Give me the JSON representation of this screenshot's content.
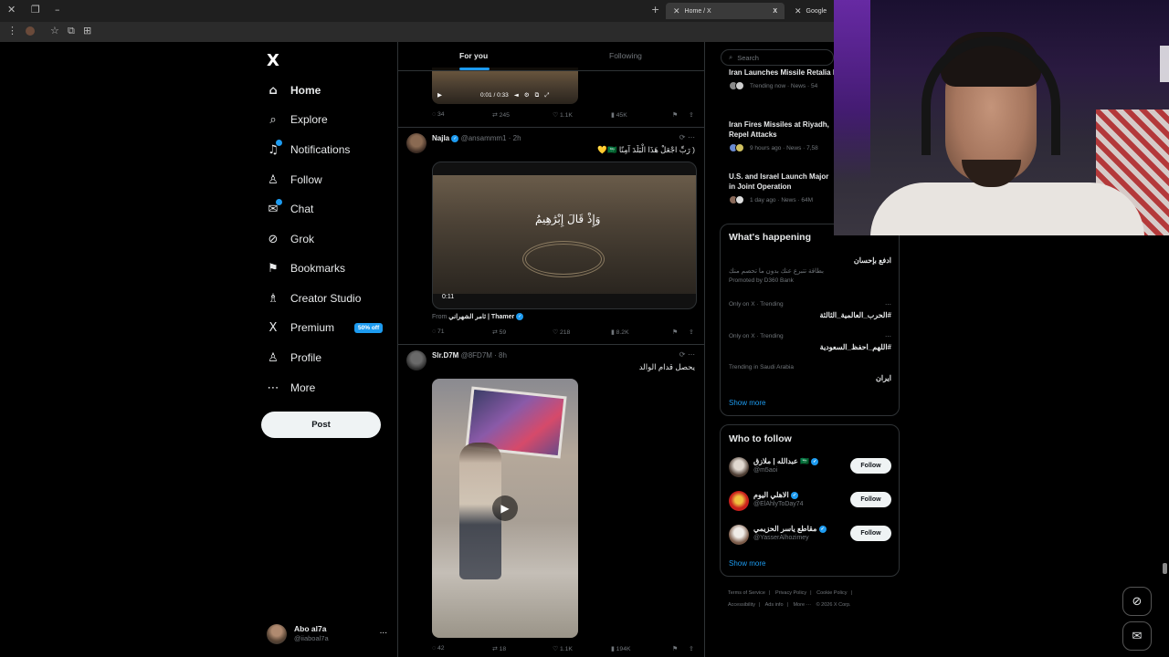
{
  "browser": {
    "tabs": [
      {
        "label": "Home / X",
        "active": true
      },
      {
        "label": "Google",
        "active": false
      }
    ]
  },
  "nav": {
    "logo": "X",
    "items": [
      {
        "label": "Home",
        "icon": "home-icon",
        "glyph": "⌂"
      },
      {
        "label": "Explore",
        "icon": "search-icon",
        "glyph": "⌕"
      },
      {
        "label": "Notifications",
        "icon": "bell-icon",
        "glyph": "♫"
      },
      {
        "label": "Follow",
        "icon": "person-add-icon",
        "glyph": "♙"
      },
      {
        "label": "Chat",
        "icon": "mail-icon",
        "glyph": "✉"
      },
      {
        "label": "Grok",
        "icon": "grok-icon",
        "glyph": "⊘"
      },
      {
        "label": "Bookmarks",
        "icon": "bookmark-icon",
        "glyph": "⚑"
      },
      {
        "label": "Creator Studio",
        "icon": "creator-icon",
        "glyph": "♗"
      },
      {
        "label": "Premium",
        "icon": "x-premium-icon",
        "glyph": "X"
      },
      {
        "label": "Profile",
        "icon": "profile-icon",
        "glyph": "♙"
      },
      {
        "label": "More",
        "icon": "more-circle-icon",
        "glyph": "⋯"
      }
    ],
    "premium_badge": "50% off",
    "post_button": "Post",
    "account": {
      "name": "Abo al7a",
      "handle": "@iiaboal7a",
      "more": "..."
    }
  },
  "feed": {
    "tabs": [
      "For you",
      "Following"
    ],
    "post0": {
      "video_time": "0:01 / 0:33",
      "actions": {
        "replies": "34",
        "reposts": "245",
        "likes": "1.1K",
        "views": "45K"
      }
    },
    "post1": {
      "name": "Najla",
      "handle": "@ansammm1",
      "time": "· 2h",
      "text": "( رَبِّ اجْعَلْ هَذَا الْبَلَدَ آمِنًا 🇸🇦💛",
      "media_caption": "وَإِذْ قَالَ إِبْرَٰهِيمُ",
      "video_time": "0:11",
      "from_label": "From",
      "from_name": "ثامر الشهراني | Thamer",
      "actions": {
        "replies": "71",
        "reposts": "59",
        "likes": "218",
        "views": "8.2K"
      }
    },
    "post2": {
      "name": "Slr.D7M",
      "handle": "@8FD7M",
      "time": "· 8h",
      "text": "يحصل قدام الوالد",
      "actions": {
        "replies": "42",
        "reposts": "18",
        "likes": "1.1K",
        "views": "194K"
      }
    }
  },
  "sidebar": {
    "search_placeholder": "Search",
    "news": [
      {
        "title": "Iran Launches Missile Retalia Bases After Strikes on Its Soi",
        "meta": "Trending now · News · 54"
      },
      {
        "title": "Iran Fires Missiles at Riyadh, Repel Attacks",
        "meta": "9 hours ago · News · 7,58"
      },
      {
        "title": "U.S. and Israel Launch Major in Joint Operation",
        "meta": "1 day ago · News · 64M"
      }
    ],
    "whats_happening": {
      "title": "What's happening",
      "promo": {
        "title": "ادفع بإحسان",
        "body": "بطاقة تتبرع عنك بدون ما تحصم منك",
        "meta": "Promoted by D360 Bank"
      },
      "trends": [
        {
          "meta": "Only on X · Trending",
          "tag": "#الحرب_العالمية_الثالثة"
        },
        {
          "meta": "Only on X · Trending",
          "tag": "#اللهم_احفظ_السعودية"
        },
        {
          "meta": "Trending in Saudi Arabia",
          "tag": "ايران"
        }
      ],
      "show_more": "Show more"
    },
    "who_to_follow": {
      "title": "Who to follow",
      "accounts": [
        {
          "name": "عبدالله | ملازق 🇸🇦",
          "handle": "@m5aoi",
          "button": "Follow"
        },
        {
          "name": "الاهلي اليوم",
          "handle": "@ElAhlyToDay74",
          "button": "Follow"
        },
        {
          "name": "مقاطع ياسر الحزيمي",
          "handle": "@YasserAlhozimey",
          "button": "Follow"
        }
      ],
      "show_more": "Show more"
    },
    "footer": [
      "Terms of Service",
      "|",
      "Privacy Policy",
      "|",
      "Cookie Policy",
      "|",
      "Accessibility",
      "|",
      "Ads info",
      "|",
      "More ···",
      "© 2026 X Corp."
    ]
  }
}
